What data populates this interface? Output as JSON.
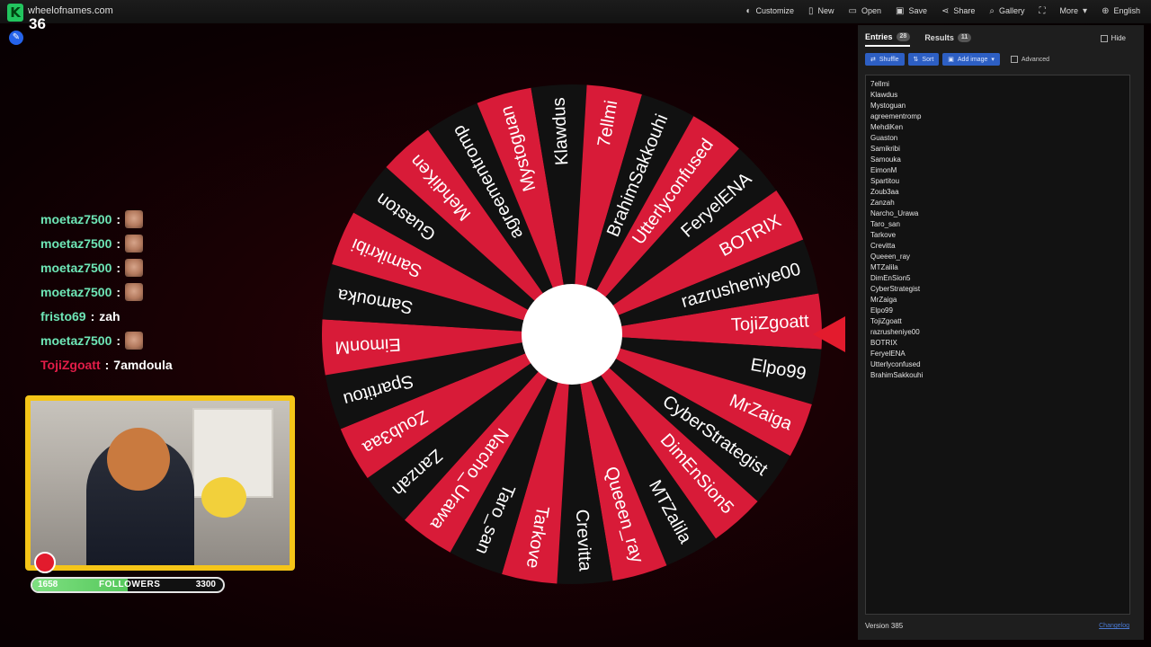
{
  "stream": {
    "viewer_count": "36",
    "chat": [
      {
        "user": "moetaz7500",
        "message": "",
        "emote": true,
        "color": "#6ee7b7"
      },
      {
        "user": "moetaz7500",
        "message": "",
        "emote": true,
        "color": "#6ee7b7"
      },
      {
        "user": "moetaz7500",
        "message": "",
        "emote": true,
        "color": "#6ee7b7"
      },
      {
        "user": "moetaz7500",
        "message": "",
        "emote": true,
        "color": "#6ee7b7"
      },
      {
        "user": "fristo69",
        "message": "zah",
        "emote": false,
        "color": "#6ee7b7"
      },
      {
        "user": "moetaz7500",
        "message": "",
        "emote": true,
        "color": "#6ee7b7"
      },
      {
        "user": "TojiZgoatt",
        "message": "7amdoula",
        "emote": false,
        "color": "#e11d48"
      }
    ],
    "followers": {
      "current": "1658",
      "label": "FOLLOWERS",
      "goal": "3300",
      "progress": 0.5
    }
  },
  "app": {
    "site_name": "wheelofnames.com",
    "menu": [
      {
        "label": "Customize",
        "icon": "palette-icon",
        "glyph": "◐"
      },
      {
        "label": "New",
        "icon": "file-icon",
        "glyph": "▯"
      },
      {
        "label": "Open",
        "icon": "folder-icon",
        "glyph": "▭"
      },
      {
        "label": "Save",
        "icon": "save-icon",
        "glyph": "▣"
      },
      {
        "label": "Share",
        "icon": "share-icon",
        "glyph": "⋖"
      },
      {
        "label": "Gallery",
        "icon": "search-icon",
        "glyph": "⌕"
      },
      {
        "label": "",
        "icon": "fullscreen-icon",
        "glyph": "⛶"
      },
      {
        "label": "More",
        "icon": "chevron-down-icon",
        "glyph": "▾"
      },
      {
        "label": "English",
        "icon": "globe-icon",
        "glyph": "⊕"
      }
    ]
  },
  "panel": {
    "tabs": [
      {
        "label": "Entries",
        "count": "28",
        "active": true
      },
      {
        "label": "Results",
        "count": "11",
        "active": false
      }
    ],
    "hide_label": "Hide",
    "toolbar": {
      "shuffle": "Shuffle",
      "sort": "Sort",
      "add_image": "Add image",
      "advanced": "Advanced"
    },
    "entries": [
      "7ellmi",
      "Klawdus",
      "Mystoguan",
      "agreementromp",
      "MehdiKen",
      "Guaston",
      "Samikribi",
      "Samouka",
      "EimonM",
      "Spartitou",
      "Zoub3aa",
      "Zanzah",
      "Narcho_Urawa",
      "Taro_san",
      "Tarkove",
      "Crevitta",
      "Queeen_ray",
      "MTZalila",
      "DimEnSion5",
      "CyberStrategist",
      "MrZaiga",
      "Elpo99",
      "TojiZgoatt",
      "razrusheniye00",
      "BOTRIX",
      "FeryelENA",
      "Utterlyconfused",
      "BrahimSakkouhi"
    ],
    "version": "Version 385",
    "changelog": "Changelog"
  },
  "wheel": {
    "colors": {
      "red": "#d81b38",
      "black": "#111111",
      "hub": "#ffffff",
      "pointer": "#e31b2d"
    },
    "segments": [
      "TojiZgoatt",
      "Elpo99",
      "MrZaiga",
      "CyberStrategist",
      "DimEnSion5",
      "MTZalila",
      "Queeen_ray",
      "Crevitta",
      "Tarkove",
      "Taro_san",
      "Narcho_Urawa",
      "Zanzah",
      "Zoub3aa",
      "Spartitou",
      "EimonM",
      "Samouka",
      "Samikribi",
      "Guaston",
      "MehdiKen",
      "agreementromp",
      "Mystoguan",
      "Klawdus",
      "7ellmi",
      "BrahimSakkouhi",
      "Utterlyconfused",
      "FeryelENA",
      "BOTRIX",
      "razrusheniye00"
    ]
  }
}
